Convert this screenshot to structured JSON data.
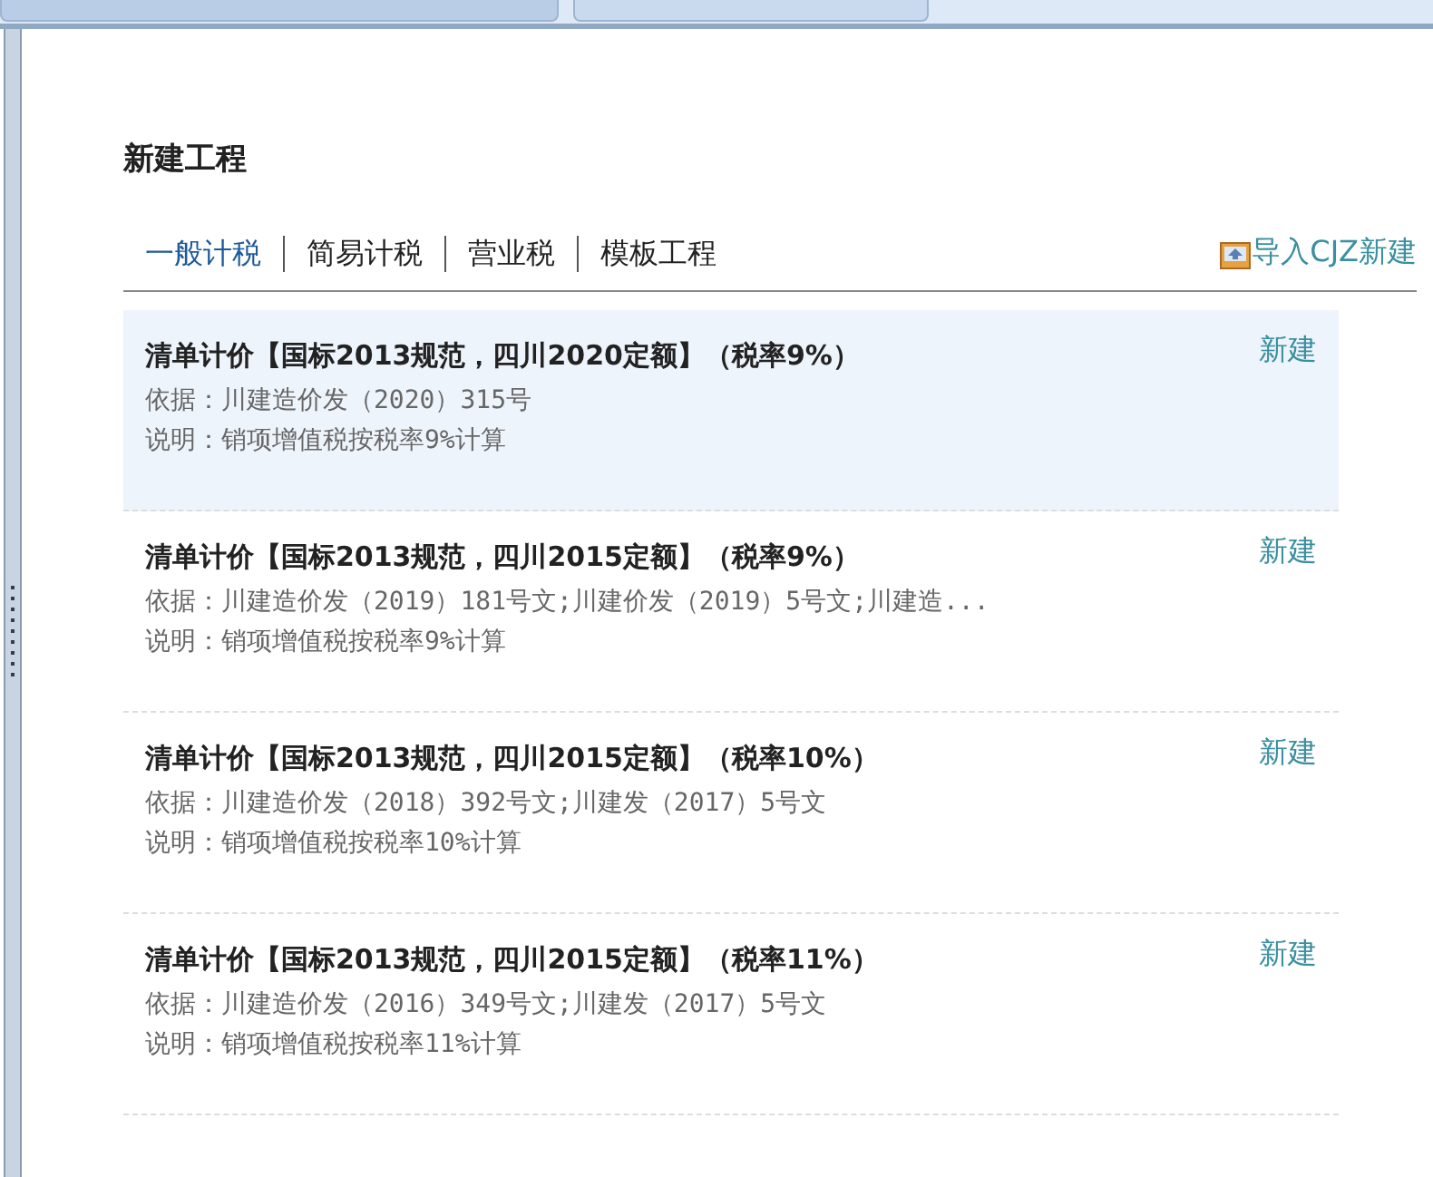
{
  "window": {
    "tabs": [
      {
        "selected": false
      },
      {
        "selected": true
      }
    ]
  },
  "title": "新建工程",
  "tabs": [
    {
      "label": "一般计税",
      "selected": true
    },
    {
      "label": "简易计税",
      "selected": false
    },
    {
      "label": "营业税",
      "selected": false
    },
    {
      "label": "模板工程",
      "selected": false
    }
  ],
  "import_link": "导入CJZ新建",
  "templates": [
    {
      "title": "清单计价【国标2013规范，四川2020定额】（税率9%）",
      "basis": "依据：川建造价发（2020）315号",
      "note": "说明：销项增值税按税率9%计算",
      "action": "新建",
      "selected": true
    },
    {
      "title": "清单计价【国标2013规范，四川2015定额】（税率9%）",
      "basis": "依据：川建造价发（2019）181号文;川建价发（2019）5号文;川建造...",
      "note": "说明：销项增值税按税率9%计算",
      "action": "新建",
      "selected": false
    },
    {
      "title": "清单计价【国标2013规范，四川2015定额】（税率10%）",
      "basis": "依据：川建造价发（2018）392号文;川建发（2017）5号文",
      "note": "说明：销项增值税按税率10%计算",
      "action": "新建",
      "selected": false
    },
    {
      "title": "清单计价【国标2013规范，四川2015定额】（税率11%）",
      "basis": "依据：川建造价发（2016）349号文;川建发（2017）5号文",
      "note": "说明：销项增值税按税率11%计算",
      "action": "新建",
      "selected": false
    }
  ]
}
